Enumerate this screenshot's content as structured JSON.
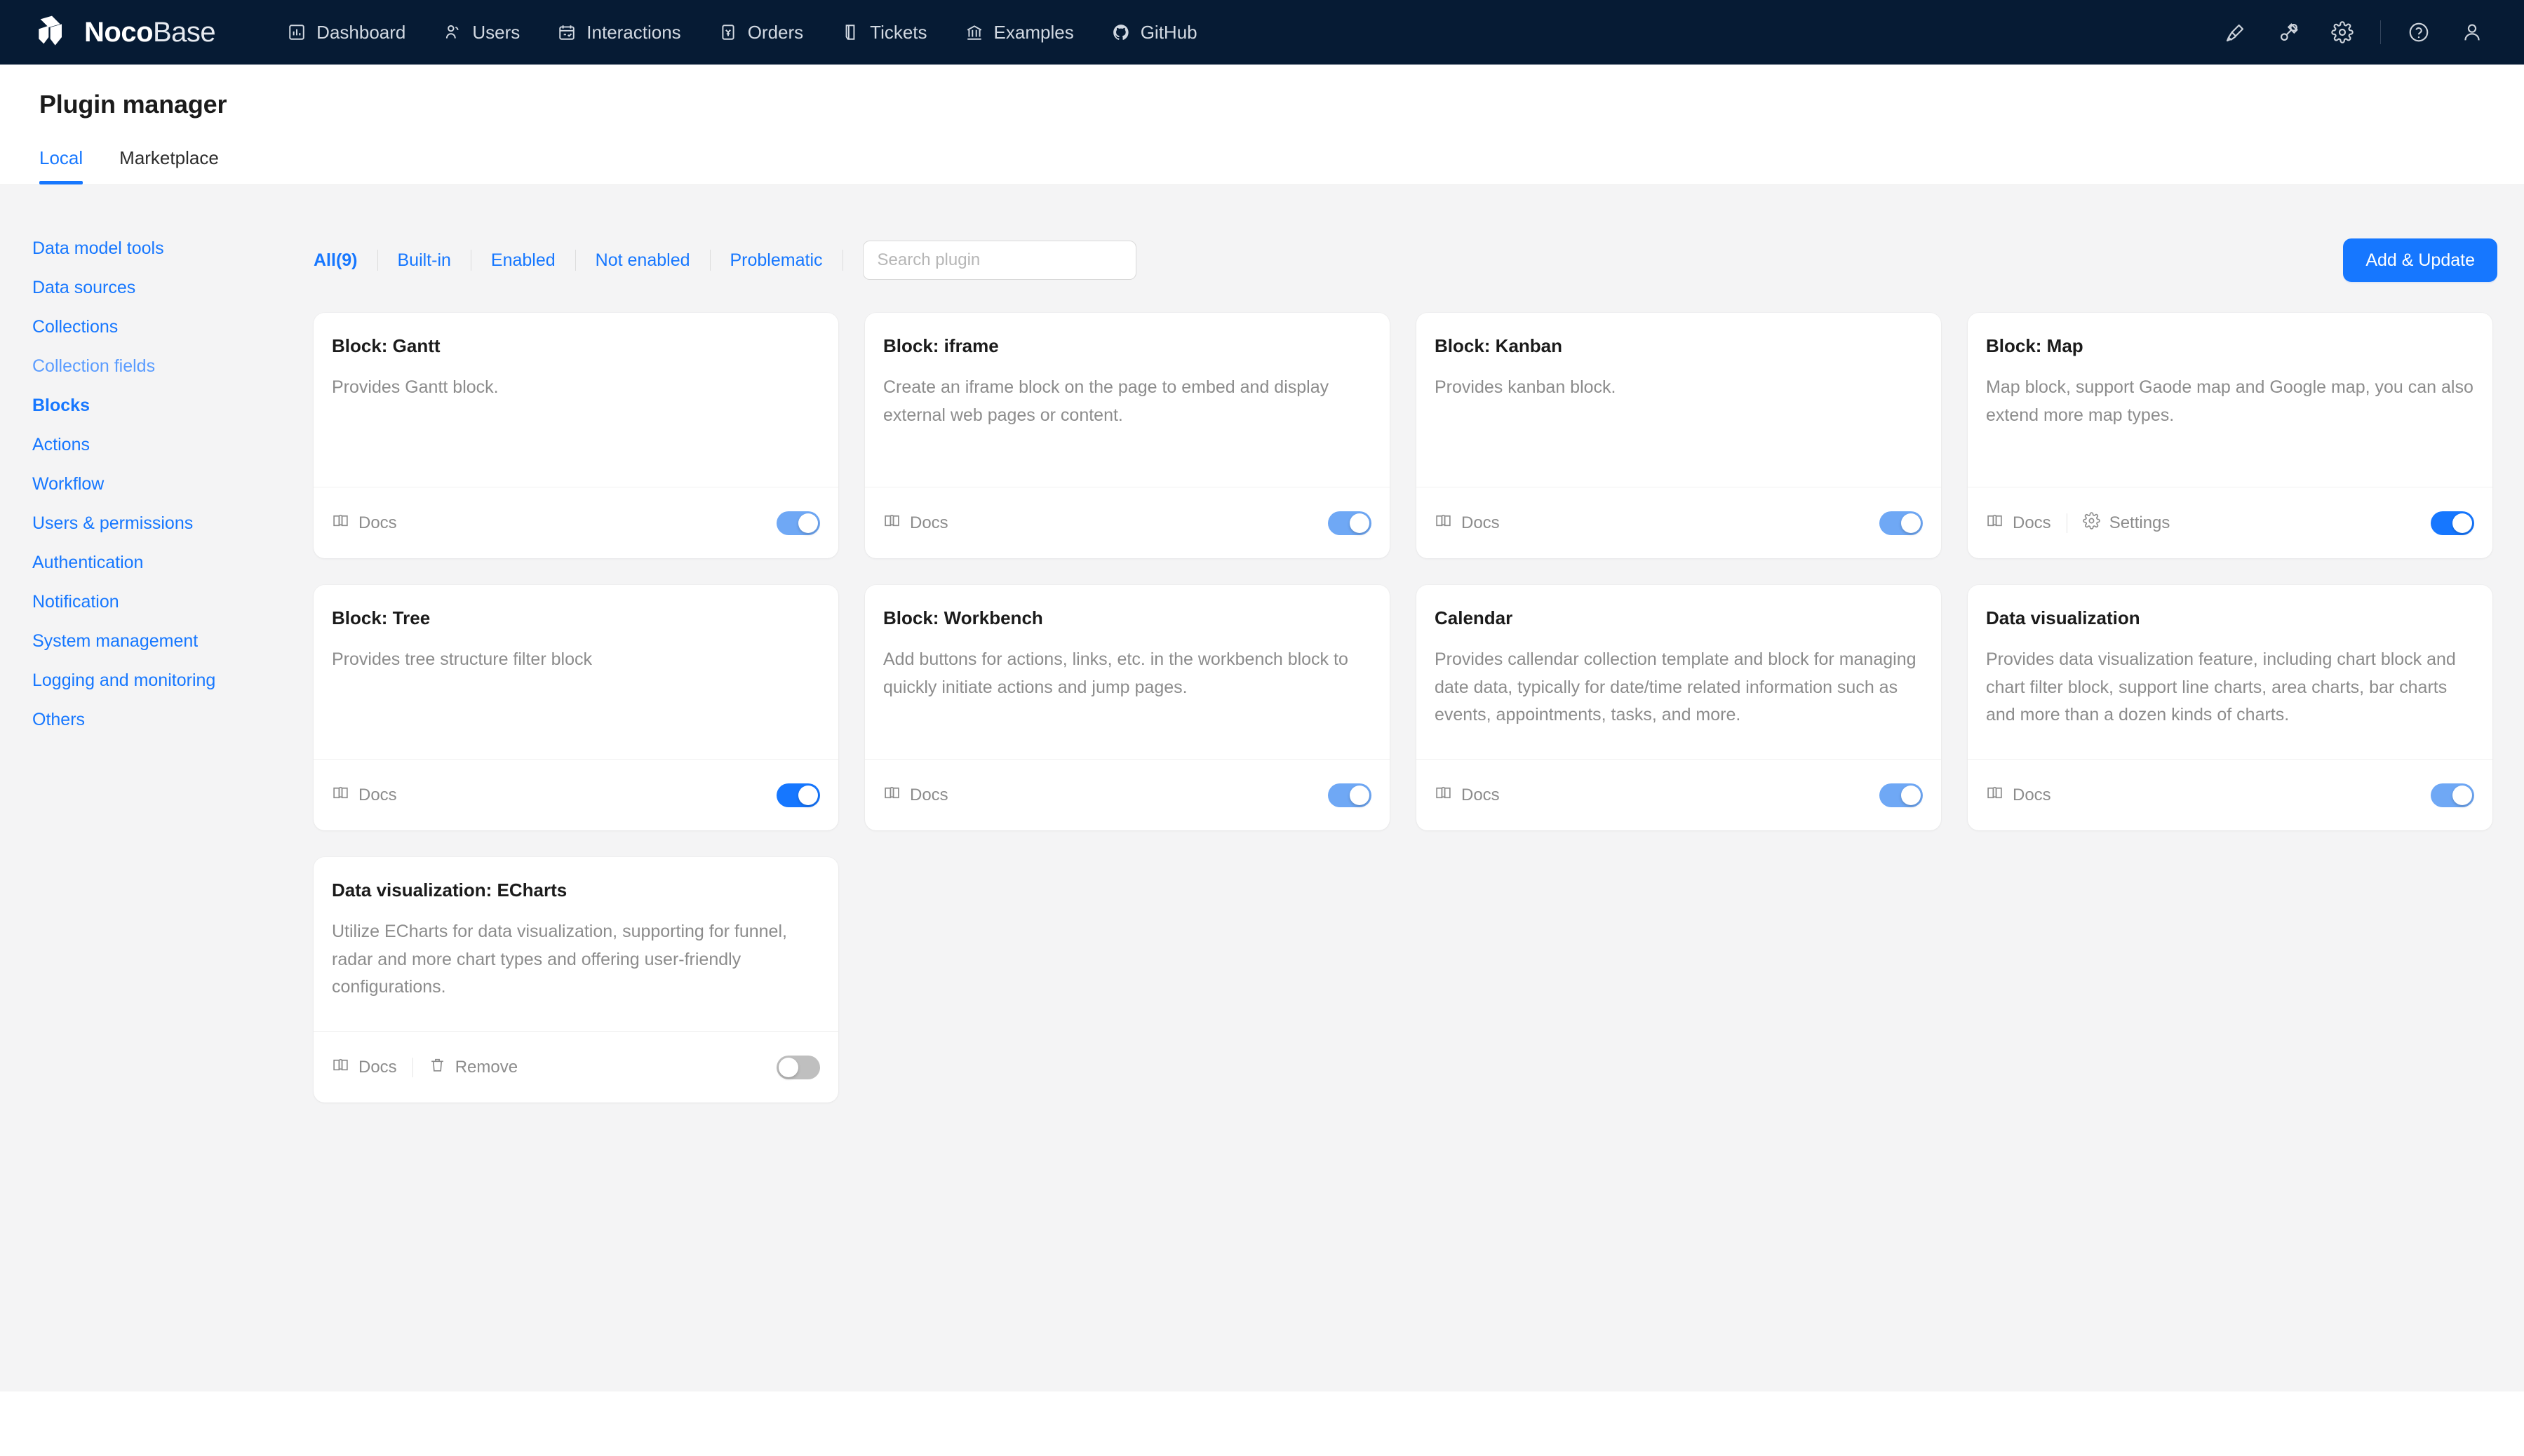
{
  "topnav": {
    "brand": {
      "bold": "Noco",
      "light": "Base",
      "logo_icon": "nocobase-logo-icon"
    },
    "items": [
      {
        "label": "Dashboard",
        "icon": "bar-chart-icon"
      },
      {
        "label": "Users",
        "icon": "user-group-icon"
      },
      {
        "label": "Interactions",
        "icon": "calendar-check-icon"
      },
      {
        "label": "Orders",
        "icon": "receipt-yen-icon"
      },
      {
        "label": "Tickets",
        "icon": "ticket-icon"
      },
      {
        "label": "Examples",
        "icon": "bank-icon"
      },
      {
        "label": "GitHub",
        "icon": "github-icon"
      }
    ],
    "right_icons": [
      {
        "name": "highlighter-icon"
      },
      {
        "name": "plugin-icon"
      },
      {
        "name": "gear-icon"
      },
      {
        "name": "help-circle-icon"
      },
      {
        "name": "user-avatar-icon"
      }
    ]
  },
  "header": {
    "title": "Plugin manager",
    "tabs": [
      {
        "label": "Local",
        "active": true
      },
      {
        "label": "Marketplace",
        "active": false
      }
    ]
  },
  "sidebar": {
    "items": [
      {
        "label": "Data model tools",
        "state": "normal"
      },
      {
        "label": "Data sources",
        "state": "normal"
      },
      {
        "label": "Collections",
        "state": "normal"
      },
      {
        "label": "Collection fields",
        "state": "hover"
      },
      {
        "label": "Blocks",
        "state": "active"
      },
      {
        "label": "Actions",
        "state": "normal"
      },
      {
        "label": "Workflow",
        "state": "normal"
      },
      {
        "label": "Users & permissions",
        "state": "normal"
      },
      {
        "label": "Authentication",
        "state": "normal"
      },
      {
        "label": "Notification",
        "state": "normal"
      },
      {
        "label": "System management",
        "state": "normal"
      },
      {
        "label": "Logging and monitoring",
        "state": "normal"
      },
      {
        "label": "Others",
        "state": "normal"
      }
    ]
  },
  "toolbar": {
    "filters": [
      {
        "label": "All(9)",
        "active": true
      },
      {
        "label": "Built-in",
        "active": false
      },
      {
        "label": "Enabled",
        "active": false
      },
      {
        "label": "Not enabled",
        "active": false
      },
      {
        "label": "Problematic",
        "active": false
      }
    ],
    "search": {
      "placeholder": "Search plugin",
      "value": ""
    },
    "add_update_label": "Add & Update"
  },
  "labels": {
    "docs": "Docs",
    "settings": "Settings",
    "remove": "Remove"
  },
  "colors": {
    "accent": "#1677ff",
    "nav_bg": "#061b34",
    "page_bg": "#f4f4f5",
    "toggle_on": "#6fa8f5",
    "toggle_on_strong": "#1677ff",
    "toggle_off": "#bfbfbf"
  },
  "plugins": [
    {
      "title": "Block: Gantt",
      "description": "Provides Gantt block.",
      "actions": [
        "docs"
      ],
      "toggle": "on"
    },
    {
      "title": "Block: iframe",
      "description": "Create an iframe block on the page to embed and display external web pages or content.",
      "actions": [
        "docs"
      ],
      "toggle": "on"
    },
    {
      "title": "Block: Kanban",
      "description": "Provides kanban block.",
      "actions": [
        "docs"
      ],
      "toggle": "on"
    },
    {
      "title": "Block: Map",
      "description": "Map block, support Gaode map and Google map, you can also extend more map types.",
      "actions": [
        "docs",
        "settings"
      ],
      "toggle": "on-strong"
    },
    {
      "title": "Block: Tree",
      "description": "Provides tree structure filter block",
      "actions": [
        "docs"
      ],
      "toggle": "on-strong"
    },
    {
      "title": "Block: Workbench",
      "description": "Add buttons for actions, links, etc. in the workbench block to quickly initiate actions and jump pages.",
      "actions": [
        "docs"
      ],
      "toggle": "on"
    },
    {
      "title": "Calendar",
      "description": "Provides callendar collection template and block for managing date data, typically for date/time related information such as events, appointments, tasks, and more.",
      "actions": [
        "docs"
      ],
      "toggle": "on"
    },
    {
      "title": "Data visualization",
      "description": "Provides data visualization feature, including chart block and chart filter block, support line charts, area charts, bar charts and more than a dozen kinds of charts.",
      "actions": [
        "docs"
      ],
      "toggle": "on"
    },
    {
      "title": "Data visualization: ECharts",
      "description": "Utilize ECharts for data visualization, supporting for funnel, radar and more chart types and offering user-friendly configurations.",
      "actions": [
        "docs",
        "remove"
      ],
      "toggle": "off"
    }
  ]
}
